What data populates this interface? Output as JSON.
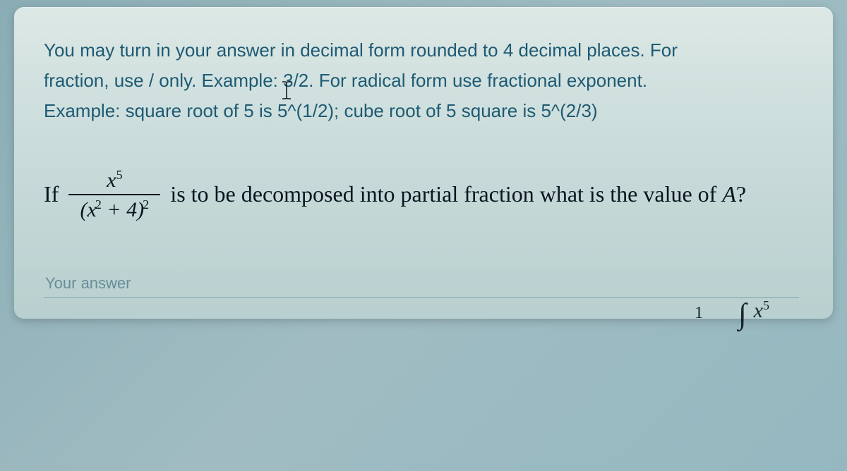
{
  "instructions": {
    "line1": "You may turn in your answer in decimal form rounded to 4 decimal places. For",
    "line2": "fraction, use / only. Example: 3/2. For radical form use fractional exponent.",
    "line3": "Example: square root of 5 is 5^(1/2); cube root of 5 square is 5^(2/3)"
  },
  "question": {
    "if": "If",
    "numerator_base": "x",
    "numerator_exp": "5",
    "denom_open": "(",
    "denom_base": "x",
    "denom_exp1": "2",
    "denom_plus": " + 4",
    "denom_close": ")",
    "denom_exp2": "2",
    "after": " is to be decomposed into partial fraction what is the value of ",
    "var": "A",
    "q": "?"
  },
  "answer_placeholder": "Your answer",
  "bottom": {
    "one": "1",
    "int": "∫",
    "x": "x",
    "exp": "5"
  }
}
